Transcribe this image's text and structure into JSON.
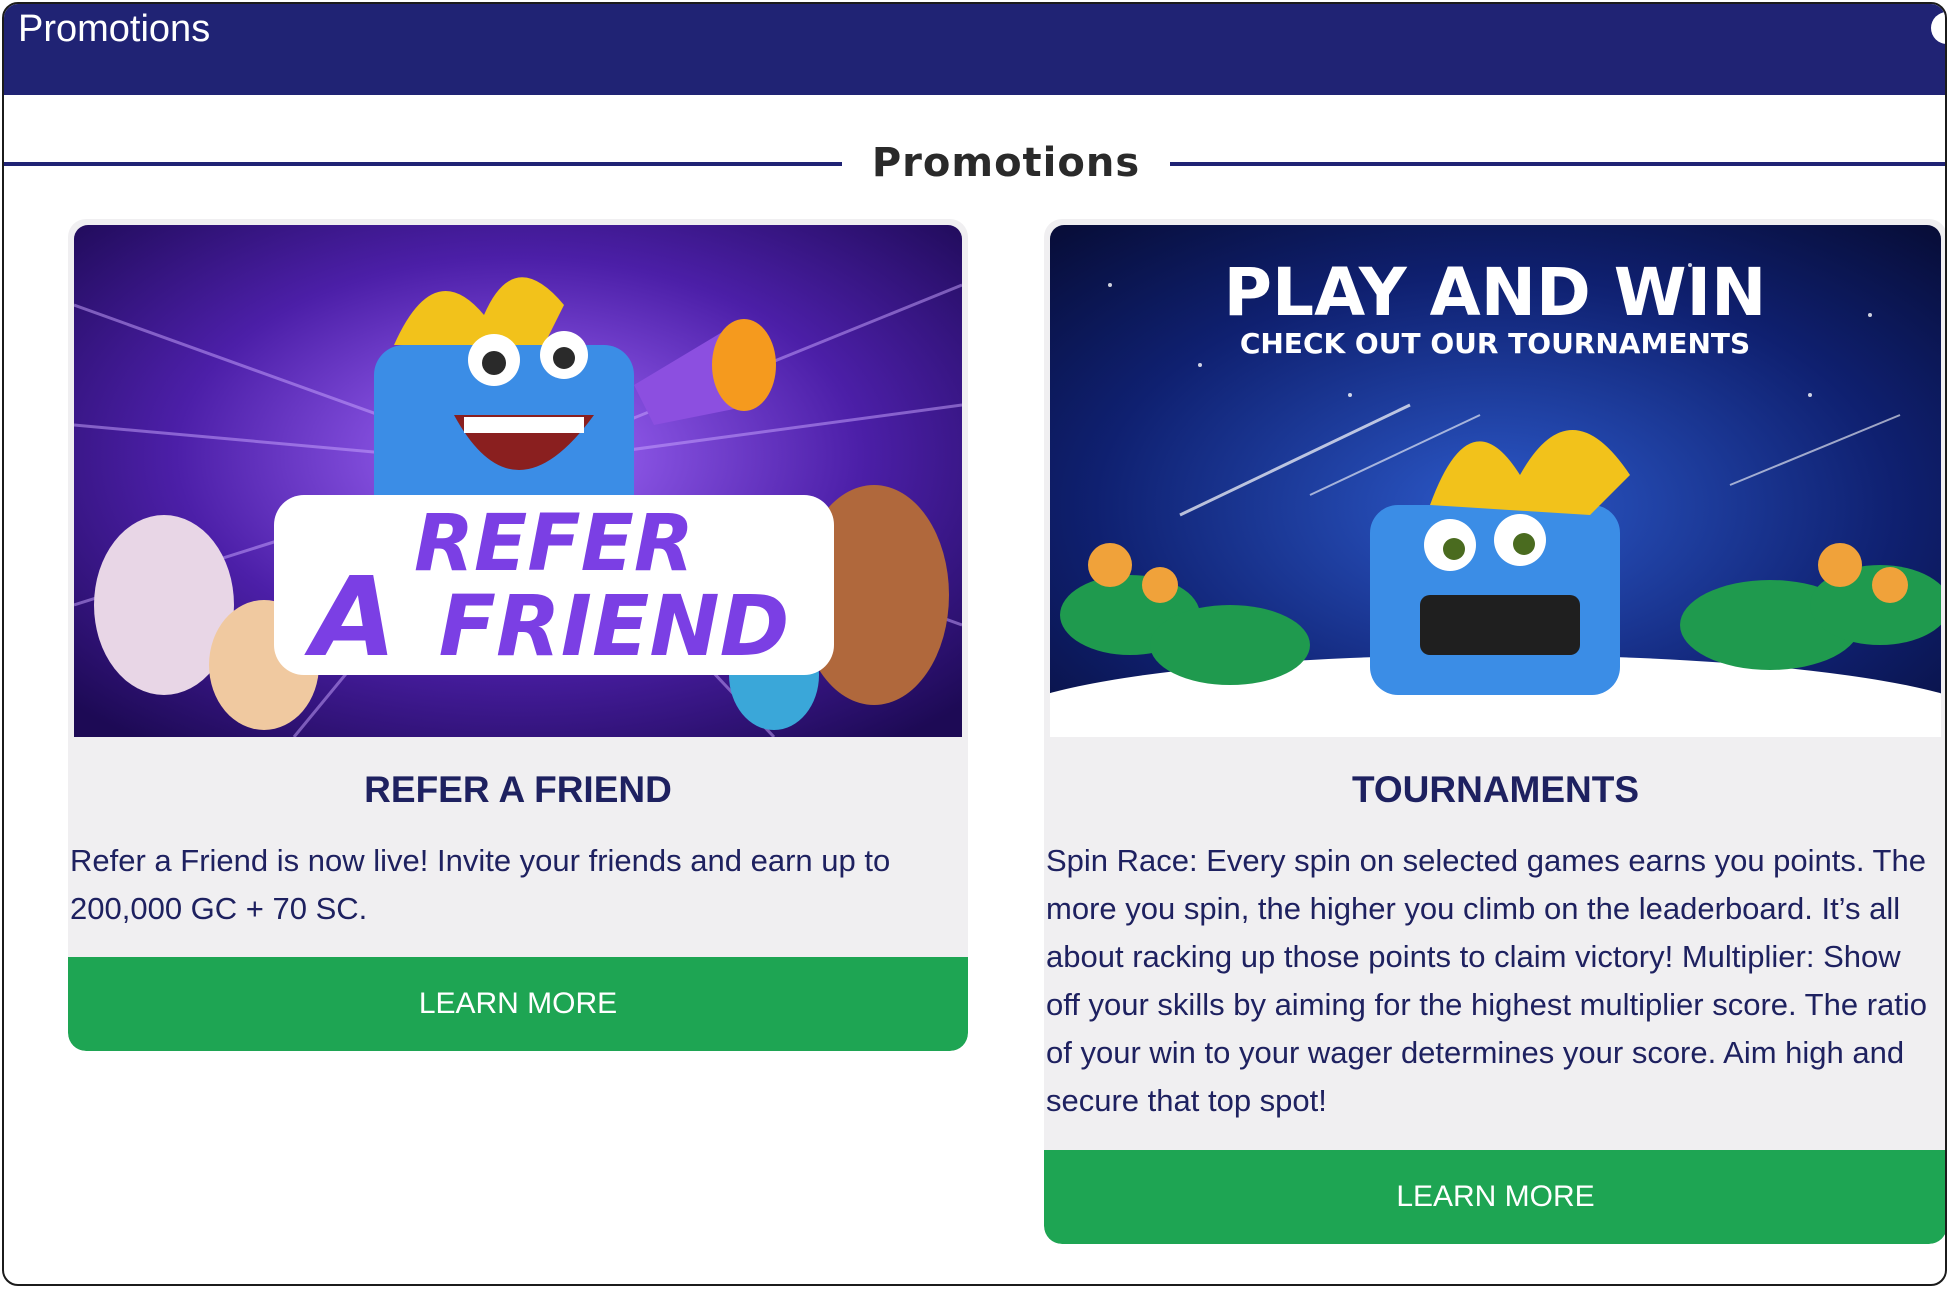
{
  "window": {
    "title": "Promotions"
  },
  "section": {
    "heading": "Promotions"
  },
  "promotions": [
    {
      "banner": {
        "line1": "REFER",
        "line2": "A",
        "line3": "FRIEND"
      },
      "title": "REFER A FRIEND",
      "description": "Refer a Friend is now live! Invite your friends and earn up to 200,000 GC + 70 SC.",
      "button_label": "LEARN MORE"
    },
    {
      "banner": {
        "headline": "PLAY AND WIN",
        "subline": "CHECK OUT OUR TOURNAMENTS"
      },
      "title": "TOURNAMENTS",
      "description": "Spin Race: Every spin on selected games earns you points. The more you spin, the higher you climb on the leaderboard. It’s all about racking up those points to claim victory! Multiplier: Show off your skills by aiming for the highest multiplier score. The ratio of your win to your wager determines your score. Aim high and secure that top spot!",
      "button_label": "LEARN MORE"
    }
  ],
  "colors": {
    "header_bg": "#202374",
    "button_bg": "#1ea553",
    "title_text": "#1e2160"
  }
}
